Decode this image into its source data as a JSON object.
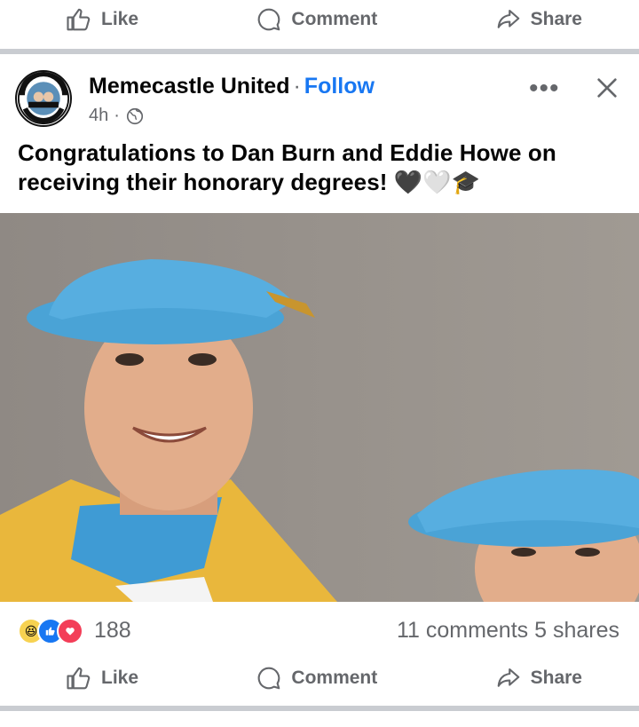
{
  "top_actions": {
    "like": "Like",
    "comment": "Comment",
    "share": "Share"
  },
  "post": {
    "page_name": "Memecastle United",
    "separator": "·",
    "follow": "Follow",
    "time": "4h",
    "time_sep": "·",
    "caption": "Congratulations to Dan Burn and Eddie Howe on receiving their honorary degrees! 🖤🤍🎓",
    "avatar_ring_text_top": "MEMECASTLE",
    "avatar_ring_text_bottom": "UNITED"
  },
  "stats": {
    "reactions_count": "188",
    "comments": "11 comments",
    "shares": "5 shares",
    "reaction_icons": [
      "haha-icon",
      "like-icon",
      "love-icon"
    ]
  },
  "bottom_actions": {
    "like": "Like",
    "comment": "Comment",
    "share": "Share"
  },
  "colors": {
    "accent": "#1877f2",
    "muted": "#65676b",
    "love": "#f33e58",
    "hat": "#4a9fd0"
  }
}
